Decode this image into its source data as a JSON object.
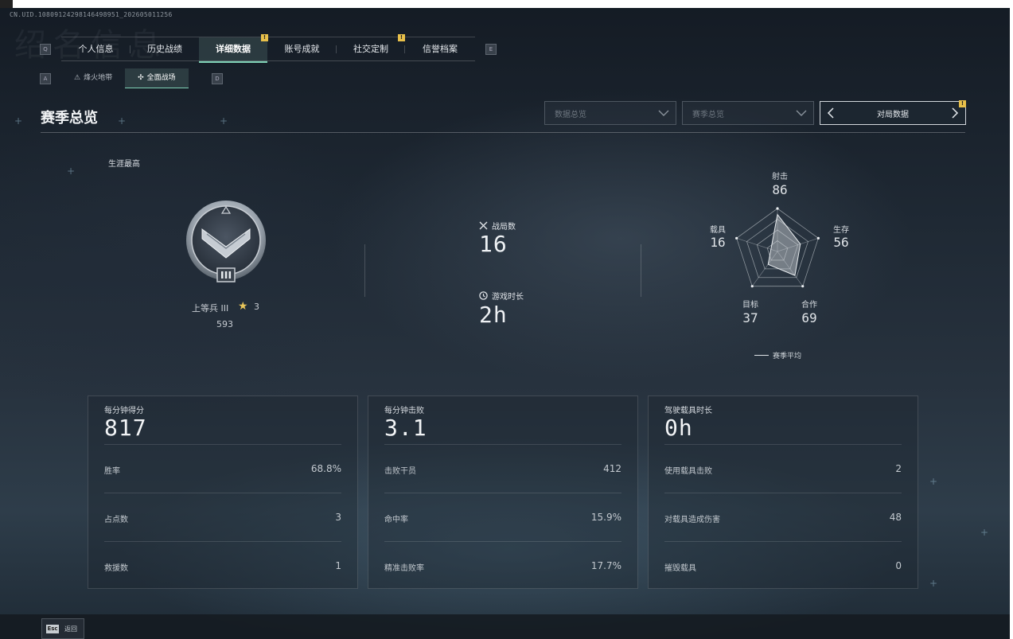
{
  "uid": "CN.UID.10809124298146498951_202605011256",
  "watermark_text": "绍名信息",
  "keyhints": {
    "tabs_left": "Q",
    "tabs_right": "E",
    "sub_left": "A",
    "sub_right": "D"
  },
  "tabs": [
    {
      "label": "个人信息",
      "active": false,
      "badge": ""
    },
    {
      "label": "历史战绩",
      "active": false,
      "badge": ""
    },
    {
      "label": "详细数据",
      "active": true,
      "badge": "!"
    },
    {
      "label": "账号成就",
      "active": false,
      "badge": ""
    },
    {
      "label": "社交定制",
      "active": false,
      "badge": "!"
    },
    {
      "label": "信誉档案",
      "active": false,
      "badge": ""
    }
  ],
  "subtabs": [
    {
      "label": "烽火地带",
      "icon": "hazard-icon",
      "active": false
    },
    {
      "label": "全面战场",
      "icon": "battlefield-icon",
      "active": true
    }
  ],
  "section_title": "赛季总览",
  "filters": {
    "data_overview": "数据总览",
    "season_overview": "赛季总览",
    "match_data": "对局数据",
    "match_badge": "!"
  },
  "career": {
    "label": "生涯最高",
    "rank_name": "上等兵 III",
    "stars": "3",
    "points": "593",
    "emblem_numeral": "III"
  },
  "summary": {
    "matches_label": "战局数",
    "matches_value": "16",
    "playtime_label": "游戏时长",
    "playtime_value": "2h"
  },
  "radar": {
    "axes": [
      {
        "label": "射击",
        "value": 86
      },
      {
        "label": "生存",
        "value": 56
      },
      {
        "label": "合作",
        "value": 69
      },
      {
        "label": "目标",
        "value": 37
      },
      {
        "label": "载具",
        "value": 16
      }
    ],
    "legend": "赛季平均"
  },
  "cards": [
    {
      "head_label": "每分钟得分",
      "head_value": "817",
      "rows": [
        {
          "k": "胜率",
          "v": "68.8%"
        },
        {
          "k": "占点数",
          "v": "3"
        },
        {
          "k": "救援数",
          "v": "1"
        }
      ]
    },
    {
      "head_label": "每分钟击败",
      "head_value": "3.1",
      "rows": [
        {
          "k": "击败干员",
          "v": "412"
        },
        {
          "k": "命中率",
          "v": "15.9%"
        },
        {
          "k": "精准击败率",
          "v": "17.7%"
        }
      ]
    },
    {
      "head_label": "驾驶载具时长",
      "head_value": "0h",
      "rows": [
        {
          "k": "使用载具击败",
          "v": "2"
        },
        {
          "k": "对载具造成伤害",
          "v": "48"
        },
        {
          "k": "摧毁载具",
          "v": "0"
        }
      ]
    }
  ],
  "footer": {
    "key": "Esc",
    "label": "返回"
  },
  "colors": {
    "accent": "#7fd1b5",
    "badge": "#e8c04a",
    "star": "#e9c65a"
  }
}
